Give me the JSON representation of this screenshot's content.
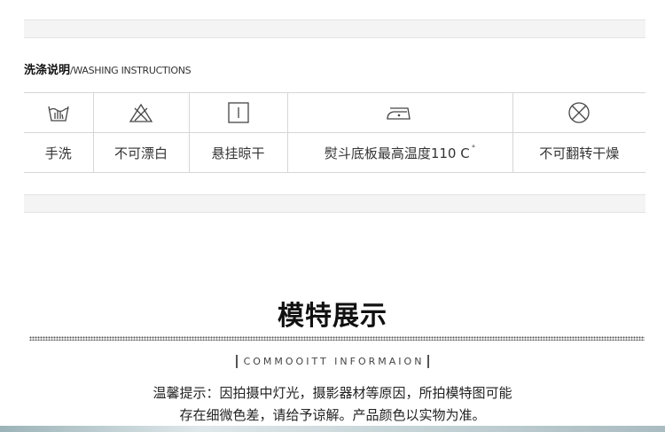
{
  "washing": {
    "title_zh": "洗涤说明",
    "title_en": "/WASHING INSTRUCTIONS",
    "items": [
      {
        "icon": "hand-wash-icon",
        "label": "手洗"
      },
      {
        "icon": "no-bleach-icon",
        "label": "不可漂白"
      },
      {
        "icon": "hang-dry-icon",
        "label": "悬挂晾干"
      },
      {
        "icon": "iron-icon",
        "label": "熨斗底板最高温度110 C",
        "suffix": "°"
      },
      {
        "icon": "no-tumble-dry-icon",
        "label": "不可翻转干燥"
      }
    ]
  },
  "model": {
    "title": "模特展示",
    "subtitle": "COMMOOITT INFORMAION",
    "tip_line1": "温馨提示：因拍摄中灯光，摄影器材等原因，所拍模特图可能",
    "tip_line2": "存在细微色差，请给予谅解。产品颜色以实物为准。"
  }
}
